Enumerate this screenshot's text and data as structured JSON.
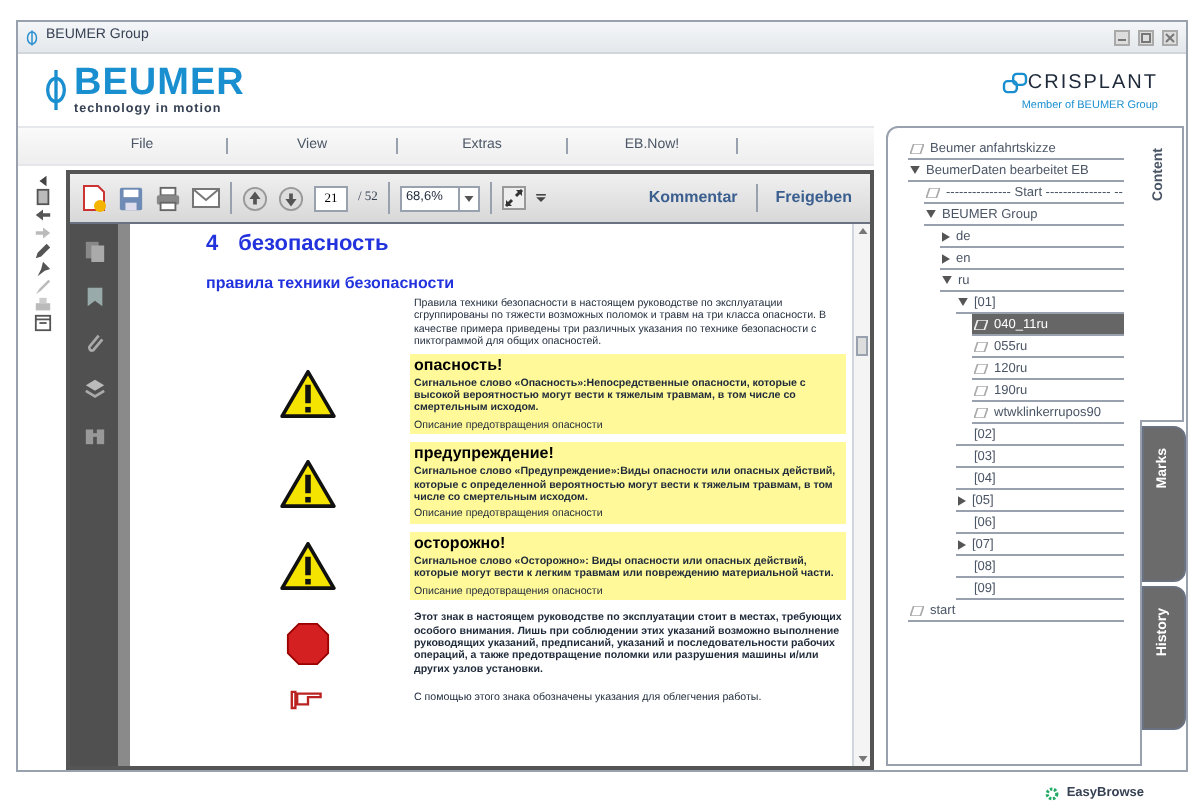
{
  "window": {
    "title": "BEUMER Group"
  },
  "header": {
    "logo": {
      "name": "BEUMER",
      "tagline": "technology in motion"
    },
    "partner": {
      "name": "CRISPLANT",
      "tagline": "Member of BEUMER Group"
    }
  },
  "menu": [
    "File",
    "View",
    "Extras",
    "EB.Now!"
  ],
  "viewer": {
    "toolbar": {
      "page": "21",
      "page_total": "/ 52",
      "zoom": "68,6%",
      "actions": [
        "Kommentar",
        "Freigeben"
      ]
    },
    "document": {
      "number": "4",
      "heading": "безопасность",
      "subheading": "правила техники безопасности",
      "intro": "Правила техники безопасности в настоящем руководстве по эксплуатации сгруппированы по тяжести возможных поломок и травм на три класса опасности. В качестве примера приведены три различных указания по технике безопасности с пиктограммой для общих опасностей.",
      "notices": [
        {
          "kind": "warning",
          "title": "опасность!",
          "text": "Сигнальное слово «Опасность»:Непосредственные опасности, которые с высокой вероятностью могут вести к тяжелым травмам, в том числе со смертельным исходом.",
          "footer": "Описание предотвращения опасности"
        },
        {
          "kind": "warning",
          "title": "предупреждение!",
          "text": "Сигнальное слово «Предупреждение»:Виды опасности или опасных действий, которые с определенной вероятностью могут вести к тяжелым травмам, в том числе со смертельным исходом.",
          "footer": "Описание предотвращения опасности"
        },
        {
          "kind": "warning",
          "title": "осторожно!",
          "text": "Сигнальное слово «Осторожно»: Виды опасности или опасных действий, которые могут вести к легким травмам или повреждению материальной части.",
          "footer": "Описание предотвращения опасности"
        }
      ],
      "notes": [
        {
          "kind": "stop",
          "text": "Этот знак в настоящем руководстве по эксплуатации стоит в местах, требующих особого внимания. Лишь при соблюдении этих указаний возможно выполнение руководящих указаний, предписаний, указаний и последовательности рабочих операций, а также предотвращение поломки или разрушения машины и/или других узлов установки."
        },
        {
          "kind": "hint",
          "text": "С помощью этого знака обозначены указания для облегчения работы."
        }
      ]
    }
  },
  "sidebar": {
    "tabs": [
      {
        "label": "Content",
        "selected": true
      },
      {
        "label": "Marks",
        "selected": false
      },
      {
        "label": "History",
        "selected": false
      }
    ],
    "tree": [
      {
        "label": "Beumer anfahrtskizze",
        "kind": "page",
        "selected": false
      },
      {
        "label": "BeumerDaten bearbeitet EB",
        "kind": "node",
        "expanded": true,
        "selected": false,
        "children": [
          {
            "label": "--------------- Start --------------- --",
            "kind": "page",
            "selected": false
          },
          {
            "label": "BEUMER Group",
            "kind": "node",
            "expanded": true,
            "selected": false,
            "children": [
              {
                "label": "de",
                "kind": "node",
                "expanded": false,
                "selected": false
              },
              {
                "label": "en",
                "kind": "node",
                "expanded": false,
                "selected": false
              },
              {
                "label": "ru",
                "kind": "node",
                "expanded": true,
                "selected": false,
                "children": [
                  {
                    "label": "[01]",
                    "kind": "node",
                    "expanded": true,
                    "selected": false,
                    "children": [
                      {
                        "label": "040_11ru",
                        "kind": "page",
                        "selected": true
                      },
                      {
                        "label": "055ru",
                        "kind": "page",
                        "selected": false
                      },
                      {
                        "label": "120ru",
                        "kind": "page",
                        "selected": false
                      },
                      {
                        "label": "190ru",
                        "kind": "page",
                        "selected": false
                      },
                      {
                        "label": "wtwklinkerrupos90",
                        "kind": "page",
                        "selected": false
                      }
                    ]
                  },
                  {
                    "label": "[02]",
                    "kind": "leaf",
                    "selected": false
                  },
                  {
                    "label": "[03]",
                    "kind": "leaf",
                    "selected": false
                  },
                  {
                    "label": "[04]",
                    "kind": "leaf",
                    "selected": false
                  },
                  {
                    "label": "[05]",
                    "kind": "node",
                    "expanded": false,
                    "selected": false
                  },
                  {
                    "label": "[06]",
                    "kind": "leaf",
                    "selected": false
                  },
                  {
                    "label": "[07]",
                    "kind": "node",
                    "expanded": false,
                    "selected": false
                  },
                  {
                    "label": "[08]",
                    "kind": "leaf",
                    "selected": false
                  },
                  {
                    "label": "[09]",
                    "kind": "leaf",
                    "selected": false
                  }
                ]
              }
            ]
          }
        ]
      },
      {
        "label": "start",
        "kind": "page",
        "selected": false
      }
    ]
  },
  "footer": {
    "brand": "EasyBrowse"
  }
}
